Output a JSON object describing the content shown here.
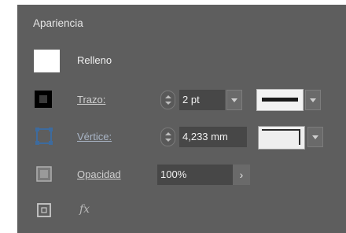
{
  "panel": {
    "title": "Apariencia"
  },
  "fill": {
    "label": "Relleno",
    "icon": "fill-swatch-icon"
  },
  "stroke": {
    "label": "Trazo:",
    "weight_value": "2 pt",
    "icon": "stroke-swatch-icon"
  },
  "vertex": {
    "label": "Vértice:",
    "radius_value": "4,233 mm",
    "icon": "corner-vertex-icon"
  },
  "opacity": {
    "label": "Opacidad",
    "value": "100%",
    "arrow": "›",
    "icon": "opacity-icon"
  },
  "effects": {
    "label": "fx",
    "icon": "add-effect-icon"
  },
  "colors": {
    "panel_bg": "#5e5e5e",
    "field_bg": "#474747",
    "vertex_accent": "#3d6b9e"
  }
}
